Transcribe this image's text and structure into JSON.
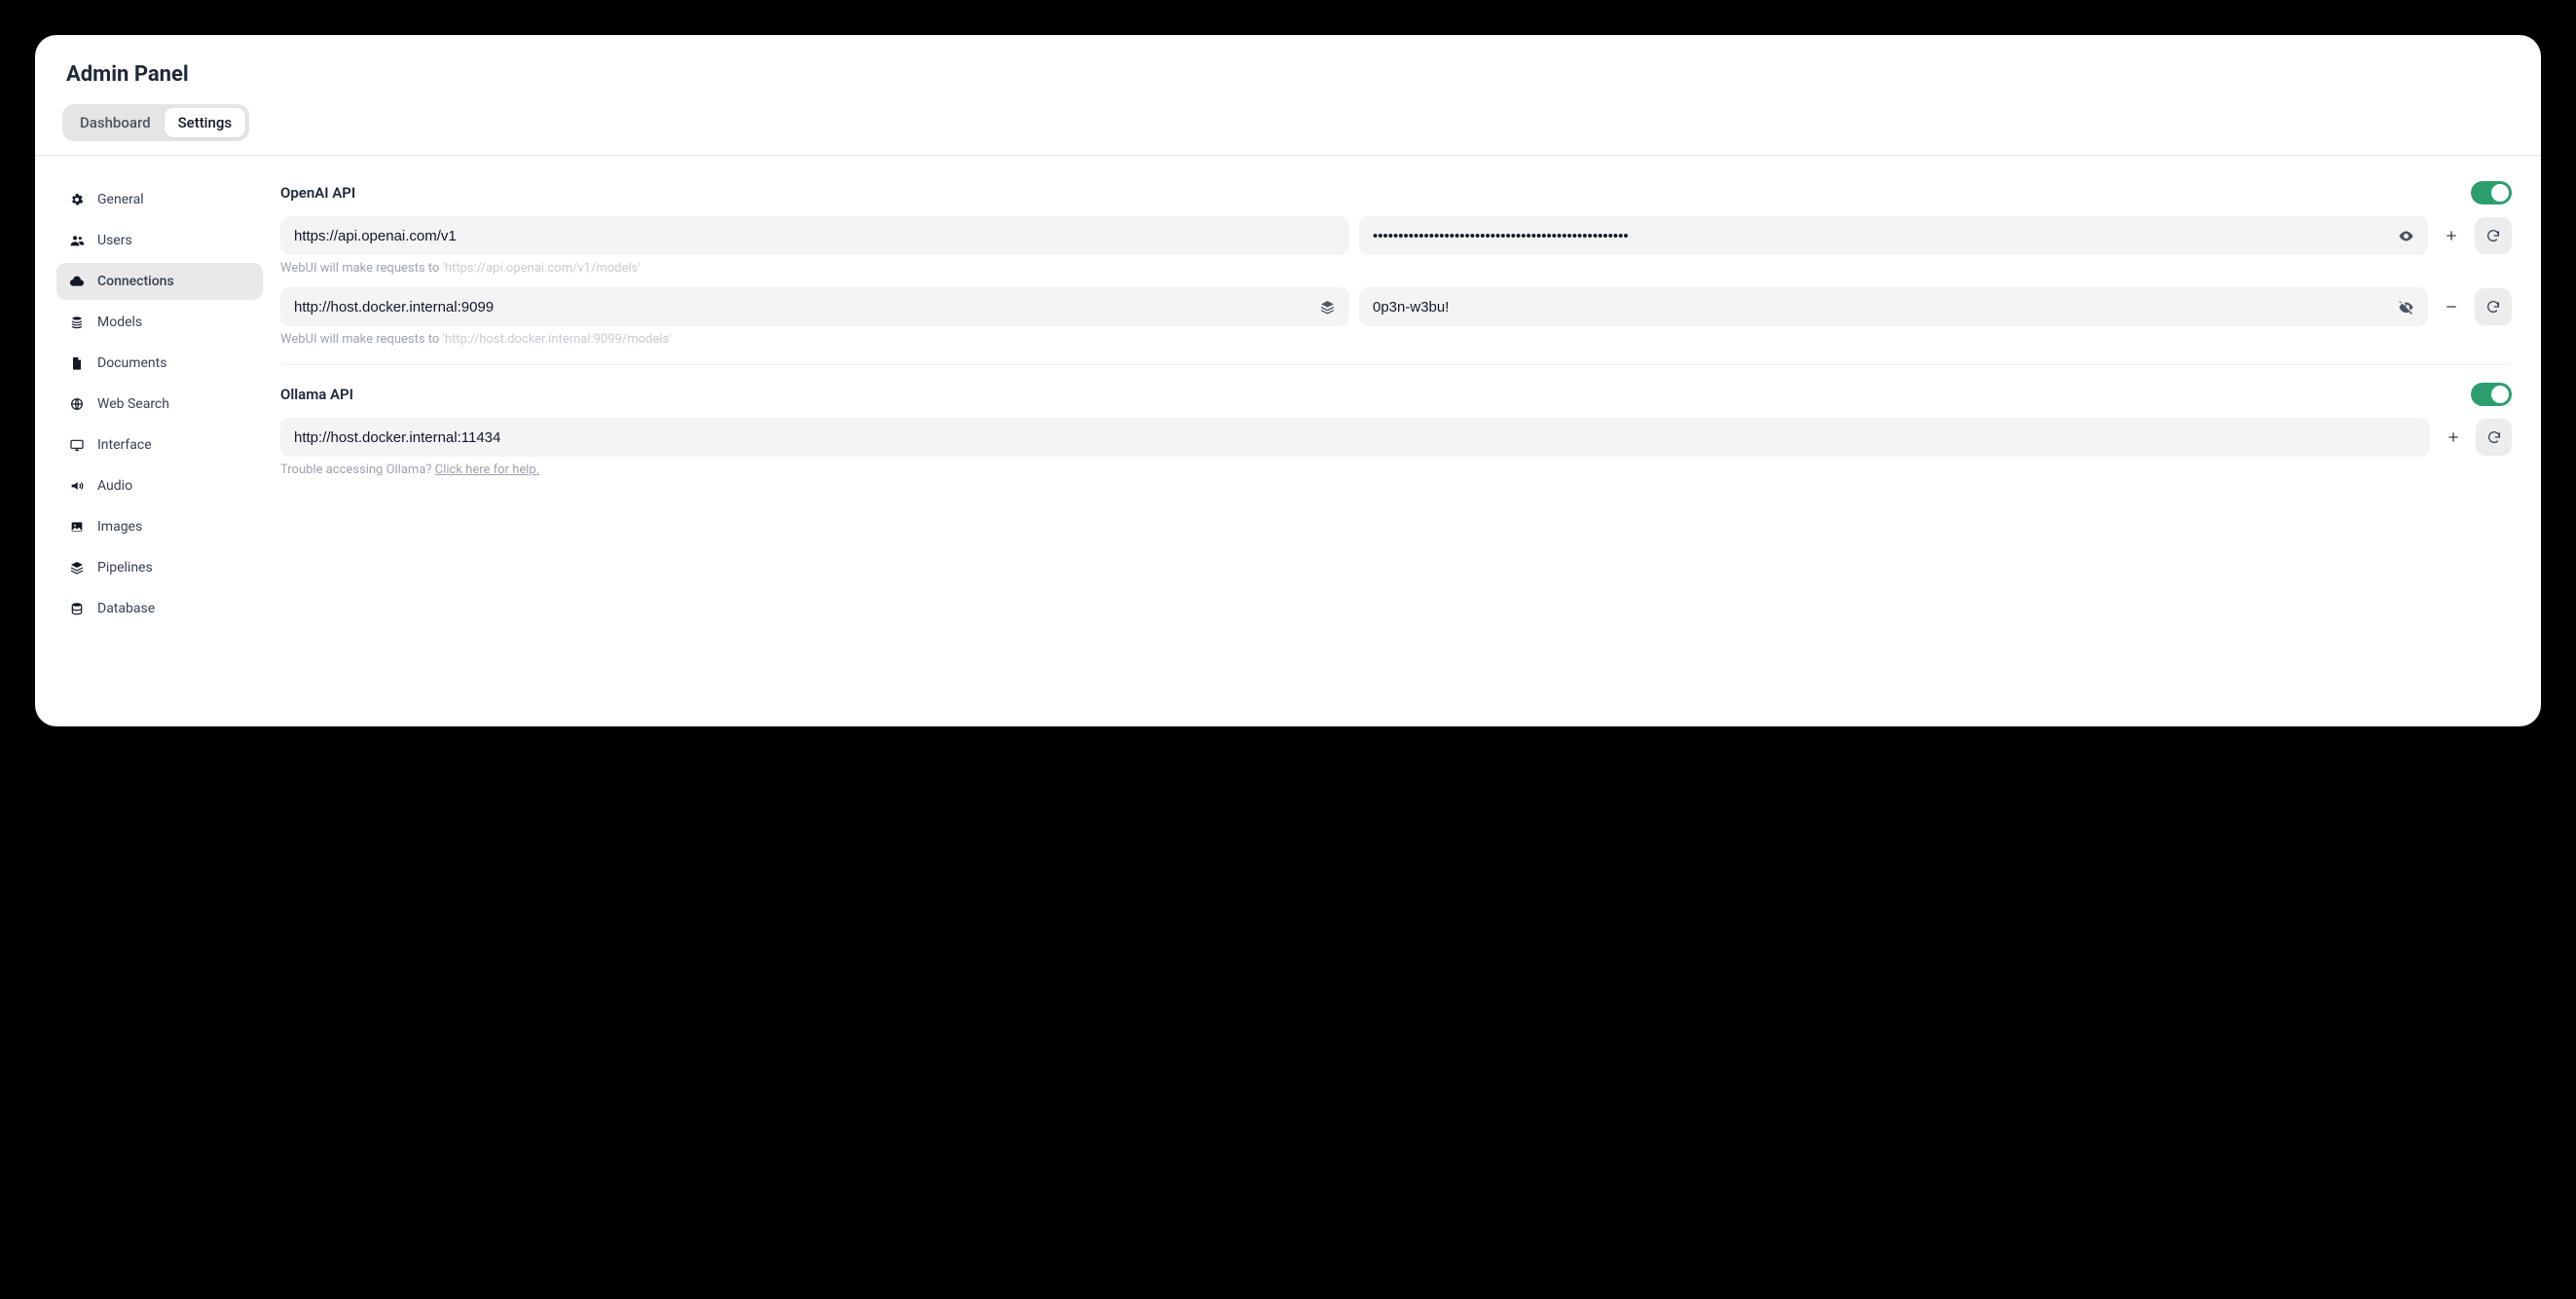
{
  "header": {
    "title": "Admin Panel",
    "tabs": [
      {
        "label": "Dashboard",
        "active": false
      },
      {
        "label": "Settings",
        "active": true
      }
    ]
  },
  "sidebar": {
    "items": [
      {
        "label": "General",
        "icon": "gear-icon"
      },
      {
        "label": "Users",
        "icon": "users-icon"
      },
      {
        "label": "Connections",
        "icon": "cloud-icon",
        "active": true
      },
      {
        "label": "Models",
        "icon": "stack-icon"
      },
      {
        "label": "Documents",
        "icon": "document-icon"
      },
      {
        "label": "Web Search",
        "icon": "globe-icon"
      },
      {
        "label": "Interface",
        "icon": "monitor-icon"
      },
      {
        "label": "Audio",
        "icon": "speaker-icon"
      },
      {
        "label": "Images",
        "icon": "image-icon"
      },
      {
        "label": "Pipelines",
        "icon": "layers-icon"
      },
      {
        "label": "Database",
        "icon": "database-icon"
      }
    ]
  },
  "openai": {
    "title": "OpenAI API",
    "enabled": true,
    "rows": [
      {
        "url": "https://api.openai.com/v1",
        "key_masked": true,
        "key_value": "",
        "hint_prefix": "WebUI will make requests to ",
        "hint_path": "'https://api.openai.com/v1/models'",
        "row_action": "add"
      },
      {
        "url": "http://host.docker.internal:9099",
        "url_layers": true,
        "key_masked": false,
        "key_value": "0p3n-w3bu!",
        "hint_prefix": "WebUI will make requests to ",
        "hint_path": "'http://host.docker.internal:9099/models'",
        "row_action": "remove"
      }
    ]
  },
  "ollama": {
    "title": "Ollama API",
    "enabled": true,
    "url": "http://host.docker.internal:11434",
    "help_prefix": "Trouble accessing Ollama? ",
    "help_link": "Click here for help."
  }
}
